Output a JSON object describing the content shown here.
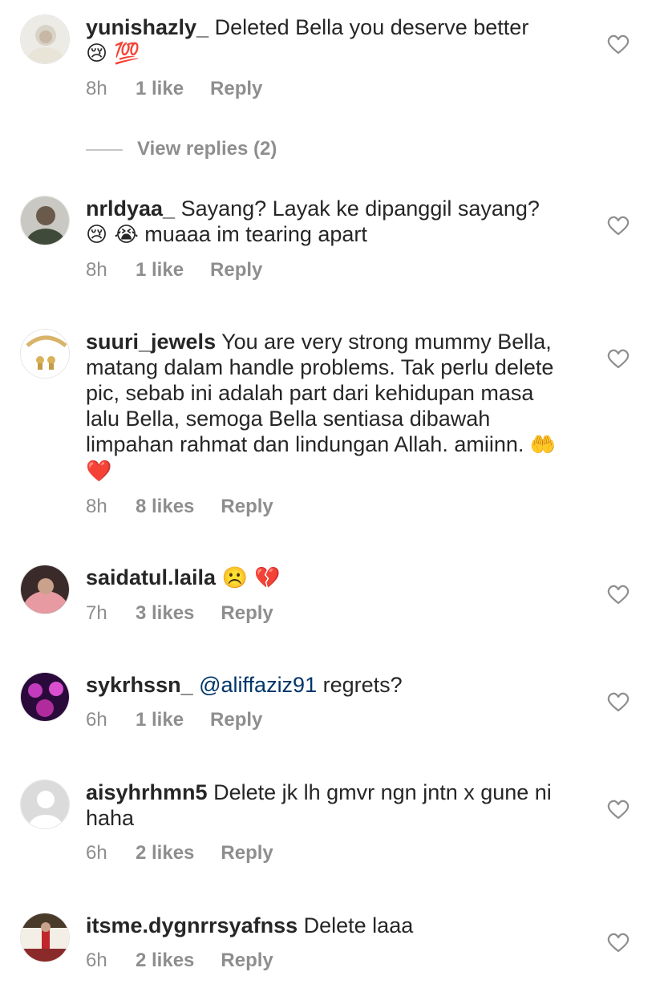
{
  "comments": [
    {
      "username": "yunishazly_",
      "text": "Deleted Bella you deserve better",
      "emoji": "😢 💯",
      "time": "8h",
      "likes": "1 like",
      "reply": "Reply"
    },
    {
      "username": "nrldyaa_",
      "text": "Sayang? Layak ke dipanggil sayang?",
      "emoji": "😢 😭",
      "text2": " muaaa im tearing apart",
      "time": "8h",
      "likes": "1 like",
      "reply": "Reply"
    },
    {
      "username": "suuri_jewels",
      "text": "You are very strong mummy Bella, matang dalam handle problems. Tak perlu delete pic, sebab ini adalah part dari kehidupan masa lalu Bella, semoga Bella sentiasa dibawah limpahan rahmat dan lindungan Allah. amiinn.",
      "emoji": "🤲 ❤️",
      "time": "8h",
      "likes": "8 likes",
      "reply": "Reply"
    },
    {
      "username": "saidatul.laila",
      "text": "",
      "emoji": "☹️ 💔",
      "time": "7h",
      "likes": "3 likes",
      "reply": "Reply"
    },
    {
      "username": "sykrhssn_",
      "mention": "@aliffaziz91",
      "text": "regrets?",
      "time": "6h",
      "likes": "1 like",
      "reply": "Reply"
    },
    {
      "username": "aisyhrhmn5",
      "text": "Delete jk lh gmvr ngn jntn x gune ni haha",
      "time": "6h",
      "likes": "2 likes",
      "reply": "Reply"
    },
    {
      "username": "itsme.dygnrrsyafnss",
      "text": "Delete laaa",
      "time": "6h",
      "likes": "2 likes",
      "reply": "Reply"
    }
  ],
  "view_replies": "View replies (2)",
  "colors": {
    "text": "#262626",
    "meta": "#8e8e8e",
    "mention": "#003569"
  }
}
